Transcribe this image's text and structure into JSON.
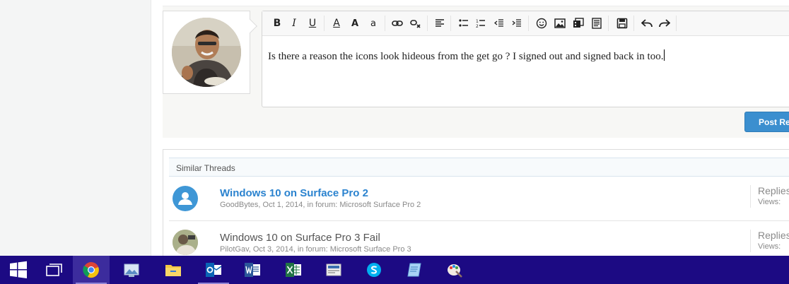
{
  "editor": {
    "text": "Is there a reason the icons look hideous from the get go ? I signed out and signed back in too.",
    "toolbar": {
      "bold": "B",
      "italic": "I",
      "underline": "U",
      "font_color": "A",
      "font_size": "A",
      "font_family": "a",
      "post_reply": "Post Reply"
    }
  },
  "similar_threads": {
    "heading": "Similar Threads",
    "threads": [
      {
        "title": "Windows 10 on Surface Pro 2",
        "meta": "GoodBytes, Oct 1, 2014, in forum: Microsoft Surface Pro 2",
        "replies_label": "Replies",
        "views_label": "Views:",
        "title_color": "#2b83cf"
      },
      {
        "title": "Windows 10 on Surface Pro 3 Fail",
        "meta": "PilotGav, Oct 3, 2014, in forum: Microsoft Surface Pro 3",
        "replies_label": "Replies",
        "views_label": "Views:",
        "title_color": "#555555"
      }
    ]
  },
  "taskbar": {
    "items": [
      "start",
      "task-view",
      "chrome",
      "photos",
      "file-explorer",
      "outlook",
      "word",
      "excel",
      "media-center",
      "skype",
      "notes",
      "paint"
    ],
    "active": "chrome"
  },
  "colors": {
    "taskbar": "#1c0a83",
    "accent_blue": "#3b8fcf",
    "link_blue": "#2b83cf"
  }
}
